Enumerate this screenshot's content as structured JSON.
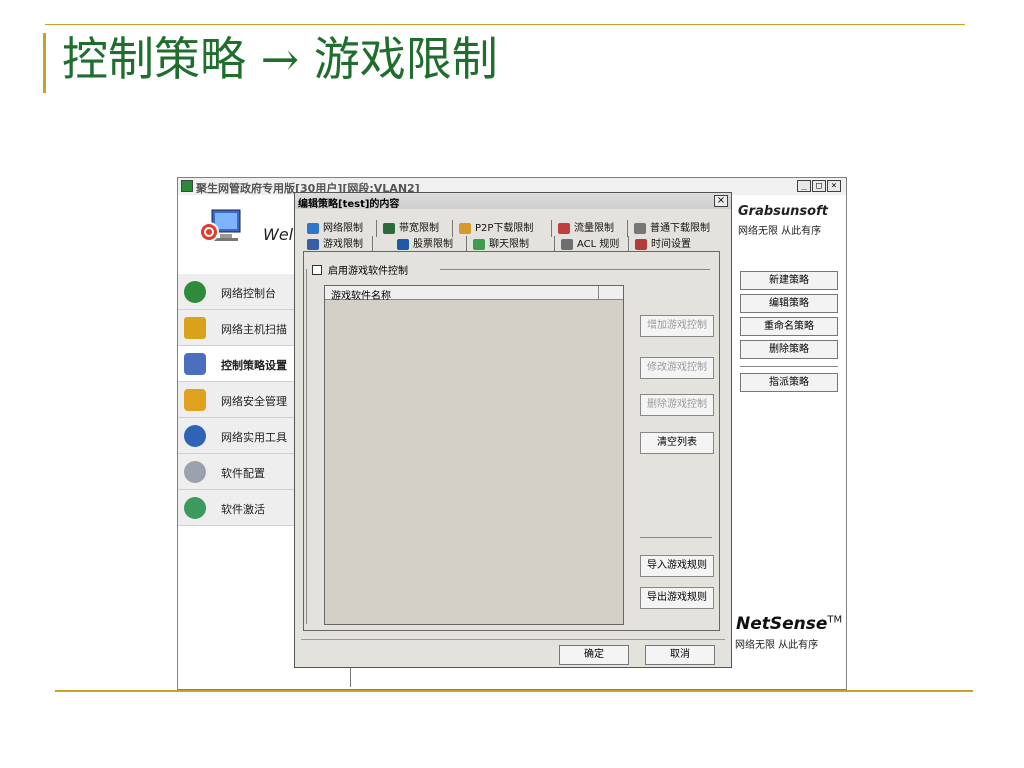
{
  "slide": {
    "title": "控制策略 → 游戏限制"
  },
  "app": {
    "title": "聚生网管政府专用版[30用户][网段:VLAN2]",
    "window_buttons": [
      "_",
      "□",
      "×"
    ],
    "welcome": "Wel",
    "nav": [
      {
        "label": "网络控制台",
        "icon": "globe-icon",
        "color": "#2e8b3a"
      },
      {
        "label": "网络主机扫描",
        "icon": "computer-scan-icon",
        "color": "#d9a21b"
      },
      {
        "label": "控制策略设置",
        "icon": "key-icon",
        "color": "#4a6fbf",
        "active": true
      },
      {
        "label": "网络安全管理",
        "icon": "lock-icon",
        "color": "#e0a020"
      },
      {
        "label": "网络实用工具",
        "icon": "tools-icon",
        "color": "#2f63b8"
      },
      {
        "label": "软件配置",
        "icon": "wrench-icon",
        "color": "#9aa2ad"
      },
      {
        "label": "软件激活",
        "icon": "activate-icon",
        "color": "#3b9a5c"
      }
    ],
    "brand": {
      "name": "Grabsunsoft",
      "slogan": "网络无限 从此有序"
    },
    "policy_buttons": [
      "新建策略",
      "编辑策略",
      "重命名策略",
      "删除策略",
      "指派策略"
    ],
    "netsense": {
      "name": "NetSense",
      "tm": "TM",
      "slogan": "网络无限 从此有序"
    }
  },
  "dialog": {
    "title": "编辑策略[test]的内容",
    "close": "×",
    "tabs_row1": [
      {
        "label": "网络限制",
        "color": "#2f76c9"
      },
      {
        "label": "带宽限制",
        "color": "#2b6b3b"
      },
      {
        "label": "P2P下载限制",
        "color": "#d79a2a"
      },
      {
        "label": "流量限制",
        "color": "#c23d3d"
      },
      {
        "label": "普通下载限制",
        "color": "#777777"
      }
    ],
    "tabs_row2": [
      {
        "label": "游戏限制",
        "color": "#3a5da8",
        "active": true
      },
      {
        "label": "股票限制",
        "color": "#1e58a8"
      },
      {
        "label": "聊天限制",
        "color": "#3e9c4a"
      },
      {
        "label": "ACL 规则",
        "color": "#6e6e6e"
      },
      {
        "label": "时间设置",
        "color": "#b53a3a"
      }
    ],
    "enable_checkbox_label": "启用游戏软件控制",
    "list_columns": [
      "游戏软件名称",
      ""
    ],
    "buttons": {
      "add": "增加游戏控制",
      "modify": "修改游戏控制",
      "delete": "删除游戏控制",
      "clear": "清空列表",
      "import": "导入游戏规则",
      "export": "导出游戏规则"
    },
    "ok": "确定",
    "cancel": "取消"
  }
}
